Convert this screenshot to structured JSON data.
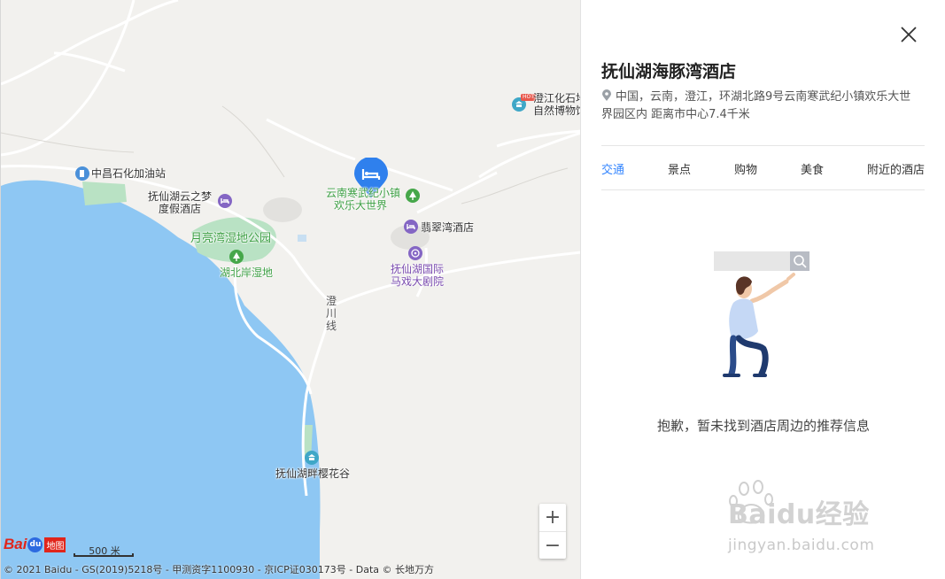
{
  "map": {
    "zoom_in": "+",
    "zoom_out": "−",
    "scale_label": "500 米",
    "copyright": "© 2021 Baidu - GS(2019)5218号 - 甲测资字1100930 - 京ICP证030173号 - Data © 长地万方",
    "logo": {
      "bai": "Bai",
      "du": "du",
      "ditu": "地图"
    },
    "road_label": "澄川线",
    "pois": {
      "gas_station": "中昌石化加油站",
      "museum_line1": "澄江化石地",
      "museum_line2": "自然博物馆",
      "museum_badge": "HOT",
      "resort_line1": "抚仙湖云之梦",
      "resort_line2": "度假酒店",
      "town_line1": "云南寒武纪小镇",
      "town_line2": "欢乐大世界",
      "feicui_hotel": "翡翠湾酒店",
      "park": "月亮湾湿地公园",
      "wetland": "湖北岸湿地",
      "circus_line1": "抚仙湖国际",
      "circus_line2": "马戏大剧院",
      "sakura": "抚仙湖畔樱花谷"
    }
  },
  "panel": {
    "hotel_name": "抚仙湖海豚湾酒店",
    "address": "中国，云南，澄江，环湖北路9号云南寒武纪小镇欢乐大世界园区内 距离市中心7.4千米",
    "tabs": [
      "交通",
      "景点",
      "购物",
      "美食",
      "附近的酒店"
    ],
    "active_tab": "交通",
    "empty_message": "抱歉，暂未找到酒店周边的推荐信息"
  },
  "watermark": {
    "line1": "Baidu经验",
    "line2": "jingyan.baidu.com"
  },
  "colors": {
    "water": "#8ec7f3",
    "land": "#f2f1ee",
    "park": "#b9e2c4",
    "accent": "#3385ff",
    "marker": "#2f80ed"
  }
}
